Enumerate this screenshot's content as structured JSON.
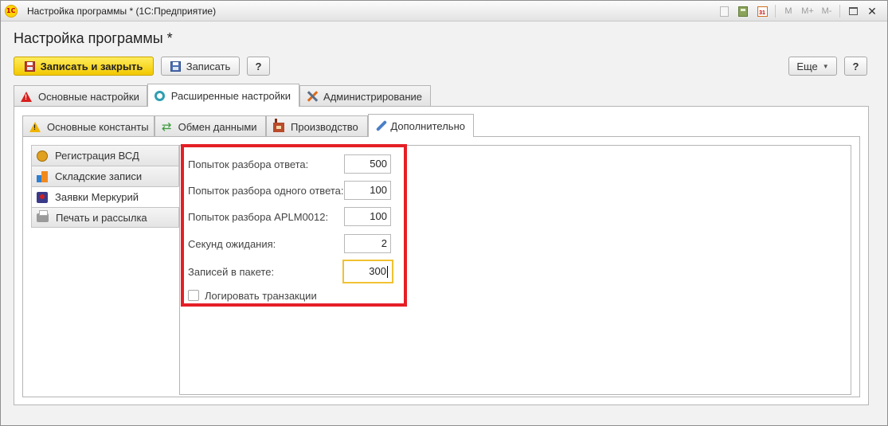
{
  "window": {
    "title": "Настройка программы * (1С:Предприятие)",
    "toolbar_m": "M",
    "toolbar_mplus": "M+",
    "toolbar_mminus": "M-",
    "calendar_day": "31",
    "close_glyph": "✕"
  },
  "form": {
    "title": "Настройка программы *"
  },
  "commands": {
    "save_close": "Записать и закрыть",
    "save": "Записать",
    "help": "?",
    "more": "Еще",
    "help_right": "?"
  },
  "tabs": [
    {
      "label": "Основные настройки",
      "icon": "warning-red-icon"
    },
    {
      "label": "Расширенные настройки",
      "icon": "gear-icon",
      "active": true
    },
    {
      "label": "Администрирование",
      "icon": "tools-icon"
    }
  ],
  "subtabs": [
    {
      "label": "Основные константы",
      "icon": "warning-icon"
    },
    {
      "label": "Обмен данными",
      "icon": "sync-icon"
    },
    {
      "label": "Производство",
      "icon": "factory-icon"
    },
    {
      "label": "Дополнительно",
      "icon": "pipette-icon",
      "active": true
    }
  ],
  "nav": [
    {
      "label": "Регистрация ВСД",
      "icon": "medal-icon"
    },
    {
      "label": "Складские записи",
      "icon": "boxes-icon"
    },
    {
      "label": "Заявки Меркурий",
      "icon": "mercury-icon",
      "active": true
    },
    {
      "label": "Печать и рассылка",
      "icon": "printer-icon"
    }
  ],
  "settings": {
    "fields": [
      {
        "label": "Попыток разбора ответа:",
        "value": "500"
      },
      {
        "label": "Попыток разбора одного ответа:",
        "value": "100"
      },
      {
        "label": "Попыток разбора APLM0012:",
        "value": "100"
      },
      {
        "label": "Секунд ожидания:",
        "value": "2"
      },
      {
        "label": "Записей в пакете:",
        "value": "300",
        "focused": true
      }
    ],
    "log_transactions": {
      "label": "Логировать транзакции",
      "checked": false
    }
  },
  "colors": {
    "accent_yellow": "#f2c800",
    "highlight_red": "#e51f26",
    "focus_border": "#f1c232"
  }
}
